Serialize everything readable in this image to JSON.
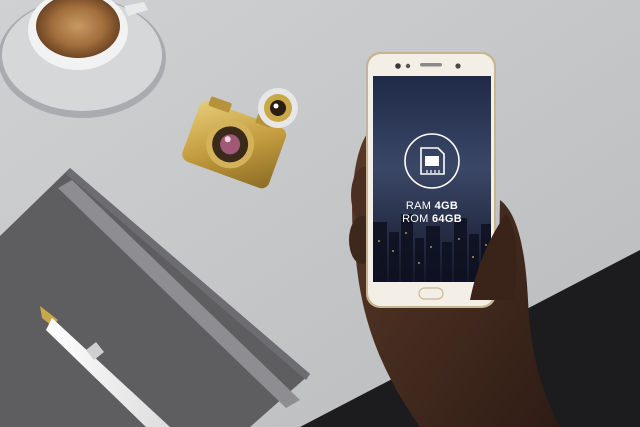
{
  "phone": {
    "ram_label": "RAM",
    "ram_value": "4GB",
    "rom_label": "ROM",
    "rom_value": "64GB",
    "screen_icon": "memory-card-icon"
  },
  "colors": {
    "background": "#c9cbcc",
    "dark_corner": "#1c1c1e",
    "notebook": "#5a595c",
    "gold": "#c9a84a",
    "phone_body": "#f0ebe3",
    "screen_sky": "#2a3550"
  }
}
